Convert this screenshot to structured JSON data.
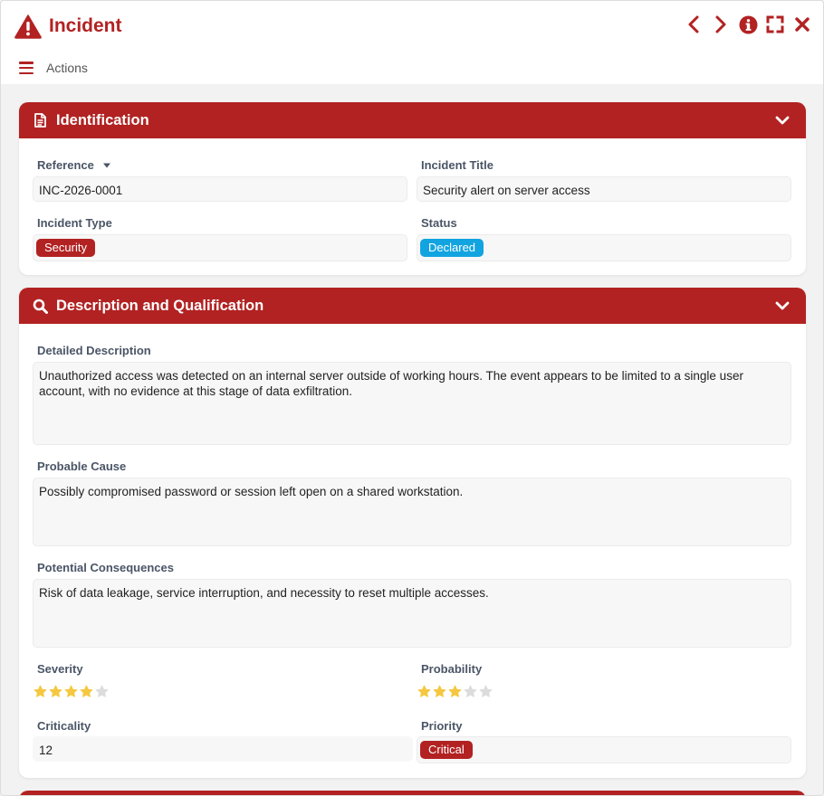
{
  "window": {
    "title": "Incident",
    "title_icon": "warning-triangle-icon",
    "actions": [
      "chevron-left-icon",
      "chevron-right-icon",
      "info-icon",
      "fullscreen-icon",
      "close-icon"
    ]
  },
  "menubar": {
    "actions_label": "Actions"
  },
  "colors": {
    "brand": "#b22222",
    "declared": "#12a4e0",
    "star_on": "#f5c842",
    "star_off": "#dcdcdc"
  },
  "identification": {
    "title": "Identification",
    "reference_label": "Reference",
    "reference_value": "INC-2026-0001",
    "incident_title_label": "Incident Title",
    "incident_title_value": "Security alert on server access",
    "incident_type_label": "Incident Type",
    "incident_type_value": "Security",
    "status_label": "Status",
    "status_value": "Declared"
  },
  "description": {
    "title": "Description and Qualification",
    "detailed_label": "Detailed Description",
    "detailed_value": "Unauthorized access was detected on an internal server outside of working hours. The event appears to be limited to a single user account, with no evidence at this stage of data exfiltration.",
    "cause_label": "Probable Cause",
    "cause_value": "Possibly compromised password or session left open on a shared workstation.",
    "consequences_label": "Potential Consequences",
    "consequences_value": "Risk of data leakage, service interruption, and necessity to reset multiple accesses.",
    "severity_label": "Severity",
    "severity_rating": 4,
    "severity_max": 5,
    "probability_label": "Probability",
    "probability_rating": 3,
    "probability_max": 5,
    "criticality_label": "Criticality",
    "criticality_value": "12",
    "priority_label": "Priority",
    "priority_value": "Critical"
  }
}
